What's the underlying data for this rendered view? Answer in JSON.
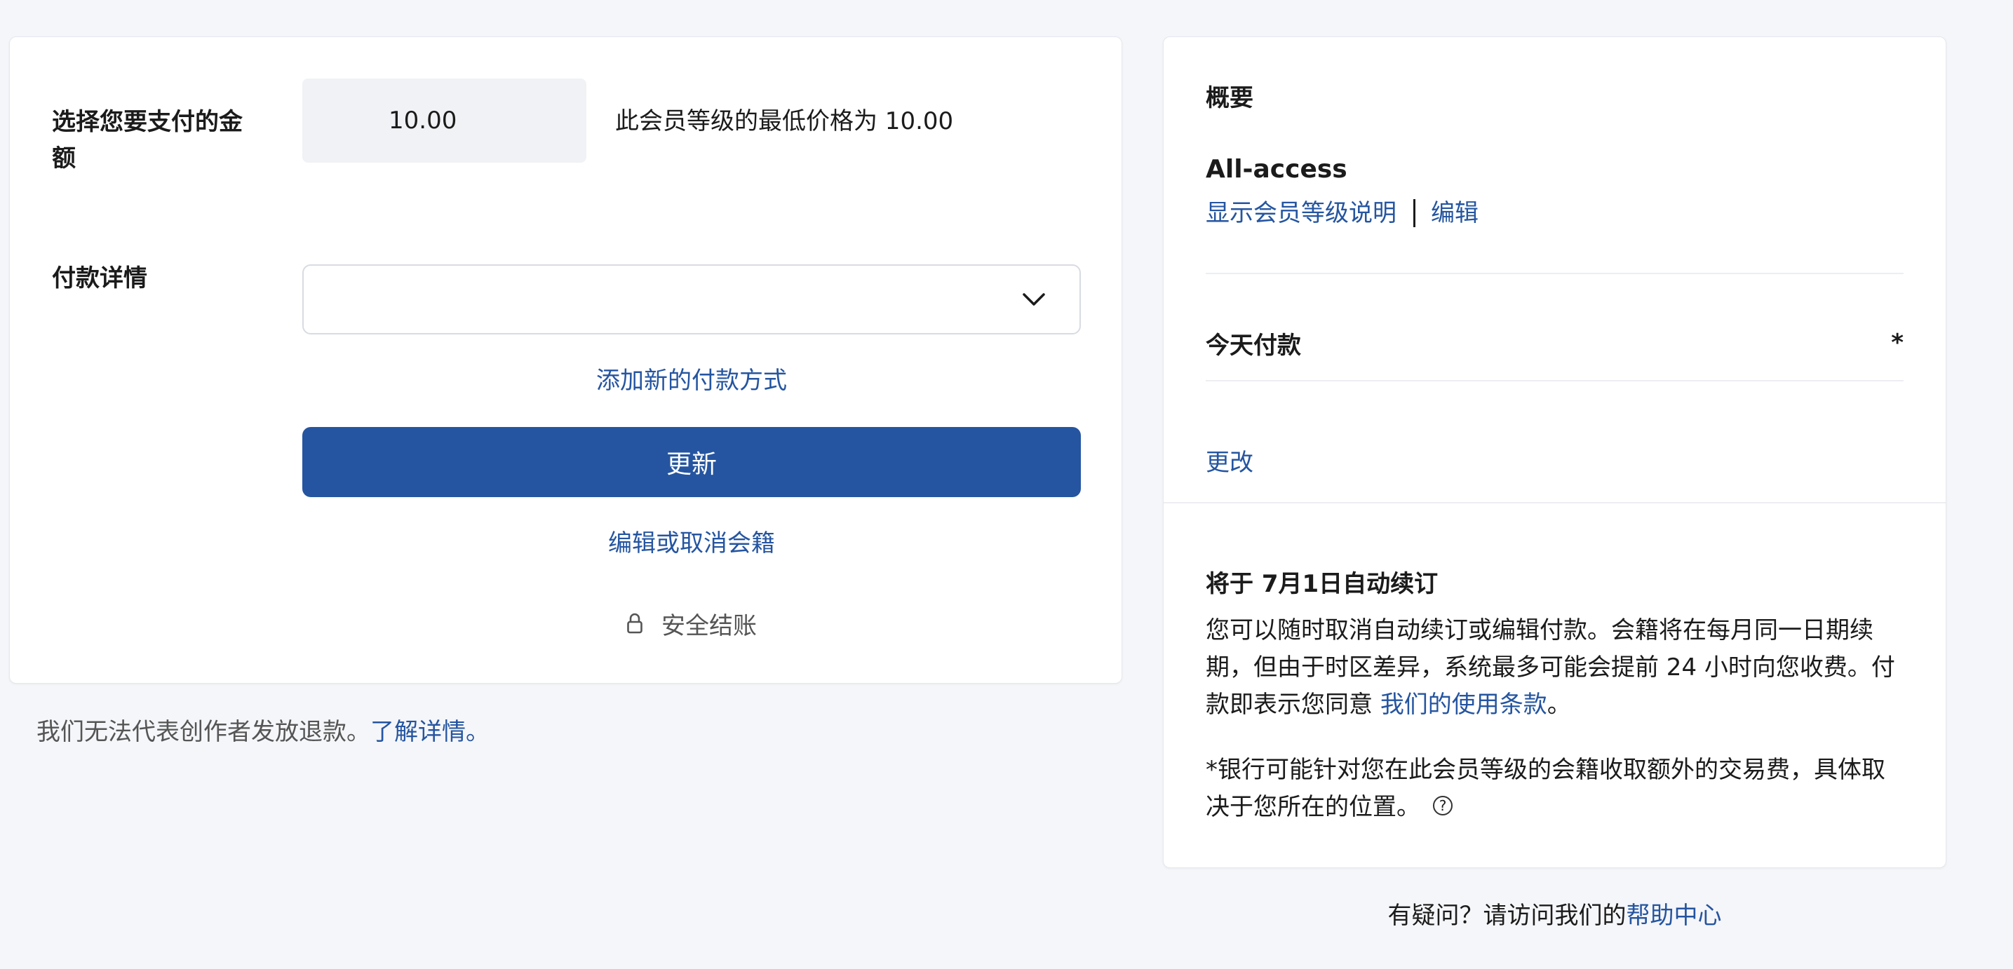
{
  "payment": {
    "amount_label": "选择您要支付的金额",
    "amount_value": "10.00",
    "min_price_text": "此会员等级的最低价格为 10.00",
    "details_label": "付款详情",
    "add_payment_method": "添加新的付款方式",
    "update_button": "更新",
    "edit_cancel_link": "编辑或取消会籍",
    "secure_checkout": "安全结账"
  },
  "refund": {
    "text": "我们无法代表创作者发放退款。",
    "link": "了解详情。"
  },
  "summary": {
    "title": "概要",
    "tier_name": "All-access",
    "show_description": "显示会员等级说明",
    "edit": "编辑",
    "today_label": "今天付款",
    "today_asterisk": "*",
    "change_link": "更改",
    "renew_title": "将于 7月1日自动续订",
    "renew_text": "您可以随时取消自动续订或编辑付款。会籍将在每月同一日期续期，但由于时区差异，系统最多可能会提前 24 小时向您收费。付款即表示您同意 ",
    "terms_link": "我们的使用条款",
    "terms_end": "。",
    "fee_text": "*银行可能针对您在此会员等级的会籍收取额外的交易费，具体取决于您所在的位置。",
    "help_icon_glyph": "?"
  },
  "footer": {
    "question": "有疑问？请访问我们的",
    "help_link": "帮助中心"
  },
  "colors": {
    "accent": "#2555a0",
    "background": "#f5f6f9",
    "card": "#ffffff"
  },
  "icons": {
    "chevron": "chevron-down-icon",
    "lock": "lock-icon",
    "help": "help-circle-icon"
  }
}
